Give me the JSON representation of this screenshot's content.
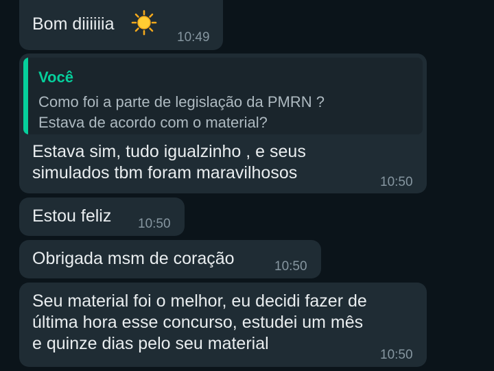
{
  "messages": [
    {
      "text": "Bom diiiiiia",
      "emoji": "sun-emoji",
      "time": "10:49"
    },
    {
      "quote": {
        "author": "Você",
        "text": "Como foi a parte de legislação da PMRN ?\nEstava de acordo com o material?"
      },
      "text": "Estava sim, tudo igualzinho , e seus\nsimulados tbm foram maravilhosos",
      "time": "10:50"
    },
    {
      "text": "Estou feliz",
      "time": "10:50"
    },
    {
      "text": "Obrigada msm de coração",
      "time": "10:50"
    },
    {
      "text": "Seu material foi o melhor, eu decidi fazer de\núltima hora esse concurso, estudei um mês\ne quinze dias pelo seu material",
      "time": "10:50"
    }
  ],
  "colors": {
    "background": "#0b141a",
    "bubble": "#1f2c34",
    "quote_accent": "#06cf9c",
    "text": "#e9edef",
    "timestamp": "#8696a0"
  }
}
